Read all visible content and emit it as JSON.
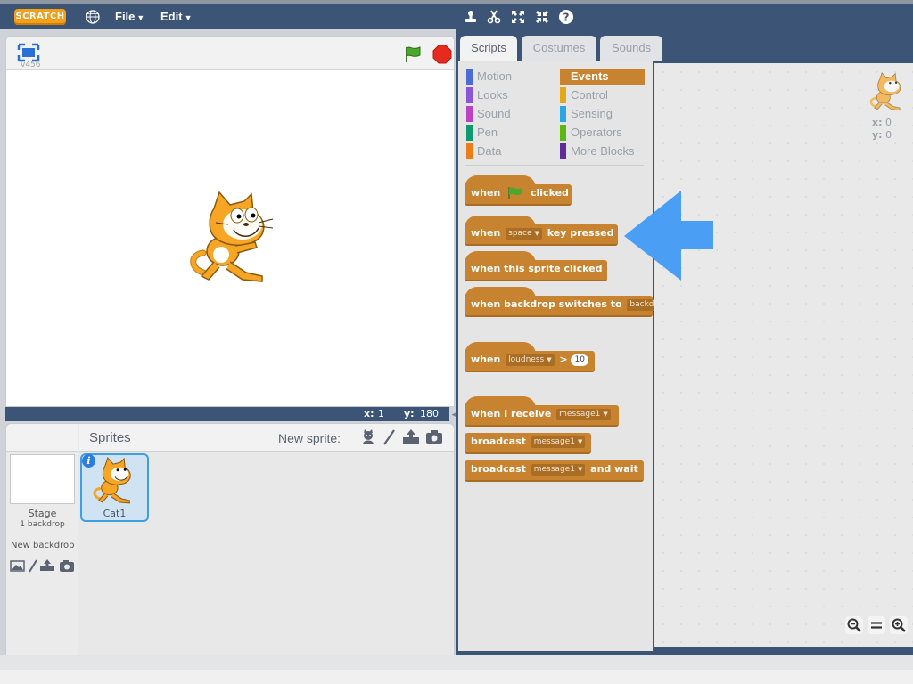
{
  "menubar": {
    "logo": "SCRATCH",
    "file_label": "File",
    "edit_label": "Edit"
  },
  "stage": {
    "version": "v456",
    "x_label": "x:",
    "x_value": "1",
    "y_label": "y:",
    "y_value": "180"
  },
  "sprites": {
    "title": "Sprites",
    "new_sprite_label": "New sprite:",
    "stage_label": "Stage",
    "stage_backdrops": "1 backdrop",
    "new_backdrop_label": "New backdrop",
    "items": [
      {
        "name": "Cat1"
      }
    ]
  },
  "tabs": [
    "Scripts",
    "Costumes",
    "Sounds"
  ],
  "categories": [
    {
      "label": "Motion",
      "color": "#4a6cd4"
    },
    {
      "label": "Looks",
      "color": "#8a55d7"
    },
    {
      "label": "Sound",
      "color": "#bb42c3"
    },
    {
      "label": "Pen",
      "color": "#0e9a6c"
    },
    {
      "label": "Data",
      "color": "#ee7d16"
    },
    {
      "label": "Events",
      "color": "#c88330"
    },
    {
      "label": "Control",
      "color": "#e1a91a"
    },
    {
      "label": "Sensing",
      "color": "#2ca5e2"
    },
    {
      "label": "Operators",
      "color": "#5cb712"
    },
    {
      "label": "More Blocks",
      "color": "#632d99"
    }
  ],
  "selected_category": "Events",
  "blocks": {
    "flag_when": "when",
    "flag_clicked": "clicked",
    "key_when": "when",
    "key_dropdown": "space",
    "key_pressed": "key pressed",
    "sprite_clicked": "when this sprite clicked",
    "backdrop_text": "when backdrop switches to",
    "backdrop_dropdown": "backdr",
    "loudness_when": "when",
    "loudness_dropdown": "loudness",
    "loudness_op": ">",
    "loudness_value": "10",
    "receive_text": "when I receive",
    "receive_dropdown": "message1",
    "broadcast_text": "broadcast",
    "broadcast_dropdown": "message1",
    "broadcast_wait_text": "broadcast",
    "broadcast_wait_dropdown": "message1",
    "broadcast_wait_suffix": "and wait"
  },
  "scripts_area": {
    "x_label": "x:",
    "x_value": "0",
    "y_label": "y:",
    "y_value": "0"
  },
  "colors": {
    "menubar": "#3c5476",
    "events": "#c88330",
    "highlight_arrow": "#4a9ff5"
  }
}
